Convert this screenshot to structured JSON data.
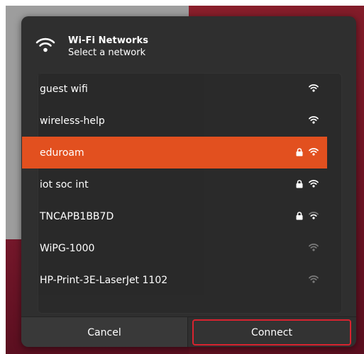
{
  "header": {
    "title": "Wi-Fi Networks",
    "subtitle": "Select a network",
    "icon": "wifi-icon"
  },
  "networks": [
    {
      "name": "guest wifi",
      "secured": false,
      "signal": "strong",
      "selected": false
    },
    {
      "name": "wireless-help",
      "secured": false,
      "signal": "strong",
      "selected": false
    },
    {
      "name": "eduroam",
      "secured": true,
      "signal": "strong",
      "selected": true
    },
    {
      "name": "iot soc int",
      "secured": true,
      "signal": "strong",
      "selected": false
    },
    {
      "name": "TNCAPB1BB7D",
      "secured": true,
      "signal": "good",
      "selected": false
    },
    {
      "name": "WiPG-1000",
      "secured": false,
      "signal": "weak",
      "selected": false
    },
    {
      "name": "HP-Print-3E-LaserJet 1102",
      "secured": false,
      "signal": "weak",
      "selected": false
    }
  ],
  "footer": {
    "cancel_label": "Cancel",
    "connect_label": "Connect"
  },
  "colors": {
    "accent": "#e2501f",
    "dialog_bg": "#2f2f2f",
    "focus_ring": "#d8232f"
  }
}
